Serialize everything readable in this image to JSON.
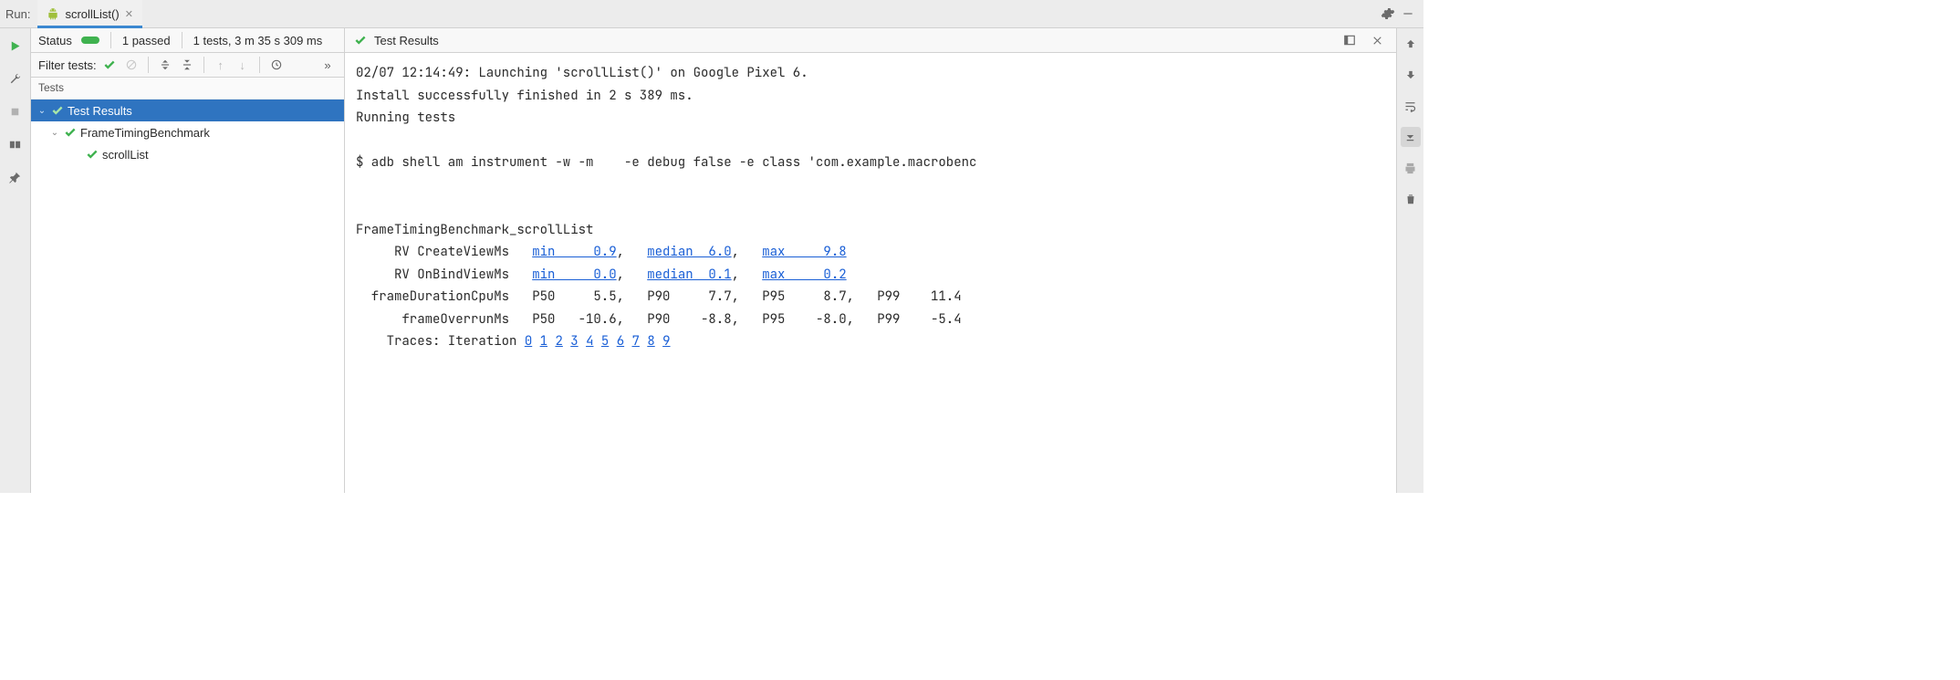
{
  "topbar": {
    "run_label": "Run:",
    "tab_title": "scrollList()"
  },
  "status": {
    "label": "Status",
    "passed": "1 passed",
    "summary": "1 tests, 3 m 35 s 309 ms"
  },
  "filter": {
    "label": "Filter tests:"
  },
  "tests_header": "Tests",
  "tree": {
    "root": "Test Results",
    "benchmark": "FrameTimingBenchmark",
    "test": "scrollList"
  },
  "crumb": {
    "label": "Test Results"
  },
  "console": {
    "line1": "02/07 12:14:49: Launching 'scrollList()' on Google Pixel 6.",
    "line2": "Install successfully finished in 2 s 389 ms.",
    "line3": "Running tests",
    "line4": "$ adb shell am instrument -w -m    -e debug false -e class 'com.example.macrobenc",
    "benchmark": {
      "title": "FrameTimingBenchmark_scrollList",
      "rows": [
        {
          "label": "RV CreateViewMs",
          "linked": true,
          "parts": [
            {
              "k": "min",
              "v": "0.9"
            },
            {
              "k": "median",
              "v": "6.0"
            },
            {
              "k": "max",
              "v": "9.8"
            }
          ]
        },
        {
          "label": "RV OnBindViewMs",
          "linked": true,
          "parts": [
            {
              "k": "min",
              "v": "0.0"
            },
            {
              "k": "median",
              "v": "0.1"
            },
            {
              "k": "max",
              "v": "0.2"
            }
          ]
        },
        {
          "label": "frameDurationCpuMs",
          "linked": false,
          "parts": [
            {
              "k": "P50",
              "v": "5.5"
            },
            {
              "k": "P90",
              "v": "7.7"
            },
            {
              "k": "P95",
              "v": "8.7"
            },
            {
              "k": "P99",
              "v": "11.4"
            }
          ]
        },
        {
          "label": "frameOverrunMs",
          "linked": false,
          "parts": [
            {
              "k": "P50",
              "v": "-10.6"
            },
            {
              "k": "P90",
              "v": "-8.8"
            },
            {
              "k": "P95",
              "v": "-8.0"
            },
            {
              "k": "P99",
              "v": "-5.4"
            }
          ]
        }
      ],
      "traces_label": "Traces: Iteration",
      "traces": [
        "0",
        "1",
        "2",
        "3",
        "4",
        "5",
        "6",
        "7",
        "8",
        "9"
      ]
    }
  },
  "icons": {
    "gear": "gear-icon",
    "minimize": "minimize-icon",
    "layout": "layout-icon",
    "closex": "close-icon",
    "play": "play-icon",
    "wrench": "wrench-icon",
    "stop": "stop-icon",
    "stack": "layout-horizontal-icon",
    "pin": "pin-icon",
    "check": "check-icon",
    "blocked": "blocked-icon",
    "expand": "expand-all-icon",
    "collapse": "collapse-all-icon",
    "up": "arrow-up-icon",
    "down": "arrow-down-icon",
    "history": "history-icon",
    "more": "more-icon",
    "arrowup": "scroll-up-icon",
    "arrowdn": "scroll-down-icon",
    "wrap": "wrap-icon",
    "scrollend": "scroll-end-icon",
    "print": "print-icon",
    "trash": "trash-icon",
    "android": "android-icon"
  }
}
